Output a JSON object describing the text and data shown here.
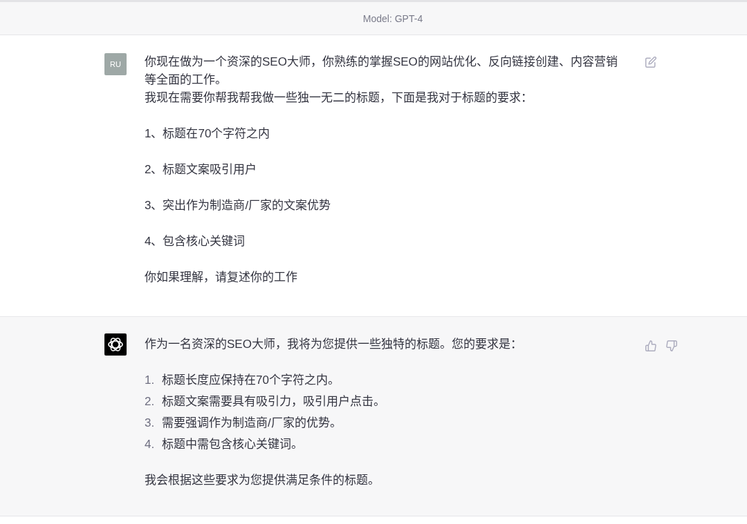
{
  "header": {
    "title": "Model: GPT-4"
  },
  "messages": [
    {
      "kind": "user",
      "avatar": "RU",
      "paragraphs": [
        [
          "你现在做为一个资深的SEO大师，你熟练的掌握SEO的网站优化、反向链接创建、内容营销等全面的工作。",
          "我现在需要你帮我帮我做一些独一无二的标题，下面是我对于标题的要求："
        ],
        [
          "1、标题在70个字符之内"
        ],
        [
          "2、标题文案吸引用户"
        ],
        [
          "3、突出作为制造商/厂家的文案优势"
        ],
        [
          "4、包含核心关键词"
        ],
        [
          "你如果理解，请复述你的工作"
        ]
      ]
    },
    {
      "kind": "assistant",
      "intro": "作为一名资深的SEO大师，我将为您提供一些独特的标题。您的要求是：",
      "list": [
        {
          "number": "1.",
          "text": "标题长度应保持在70个字符之内。"
        },
        {
          "number": "2.",
          "text": "标题文案需要具有吸引力，吸引用户点击。"
        },
        {
          "number": "3.",
          "text": "需要强调作为制造商/厂家的优势。"
        },
        {
          "number": "4.",
          "text": "标题中需包含核心关键词。"
        }
      ],
      "outro": "我会根据这些要求为您提供满足条件的标题。"
    }
  ]
}
